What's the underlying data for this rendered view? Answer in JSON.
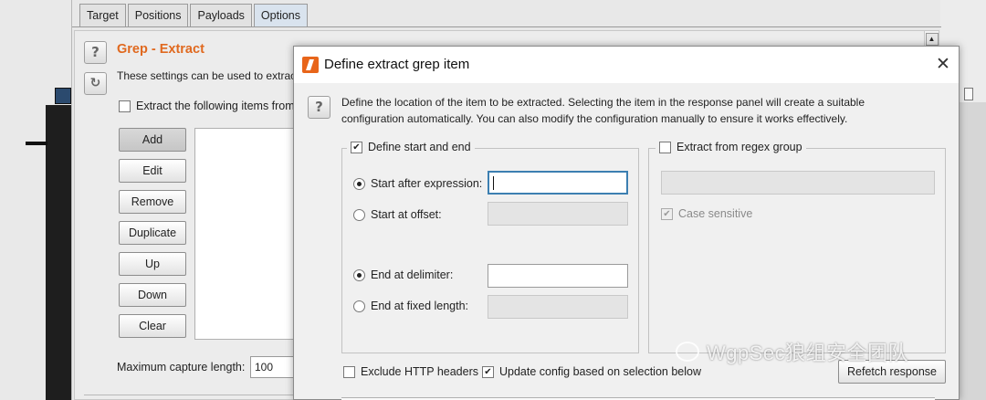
{
  "tabs": [
    "Target",
    "Positions",
    "Payloads",
    "Options"
  ],
  "grep": {
    "title": "Grep - Extract",
    "description": "These settings can be used to extract useful information from responses into the attack results table.",
    "extract_checkbox": "Extract the following items from responses:",
    "buttons": [
      "Add",
      "Edit",
      "Remove",
      "Duplicate",
      "Up",
      "Down",
      "Clear"
    ],
    "max_capture_label": "Maximum capture length:",
    "max_capture_value": "100"
  },
  "dialog": {
    "title": "Define extract grep item",
    "description": "Define the location of the item to be extracted. Selecting the item in the response panel will create a suitable configuration automatically. You can also modify the configuration manually to ensure it works effectively.",
    "define_start_end": "Define start and end",
    "start_after_expression": "Start after expression:",
    "start_at_offset": "Start at offset:",
    "end_at_delimiter": "End at delimiter:",
    "end_at_fixed_length": "End at fixed length:",
    "extract_regex": "Extract from regex group",
    "case_sensitive": "Case sensitive",
    "exclude_http_headers": "Exclude HTTP headers",
    "update_config": "Update config based on selection below",
    "refetch_response": "Refetch response",
    "start_after_value": "",
    "end_delimiter_value": ""
  },
  "watermark": "WgpSec狼组安全团队",
  "colors": {
    "accent_orange": "#e0691f",
    "burp_logo": "#e8651a",
    "focus_blue": "#3c7fb1"
  }
}
